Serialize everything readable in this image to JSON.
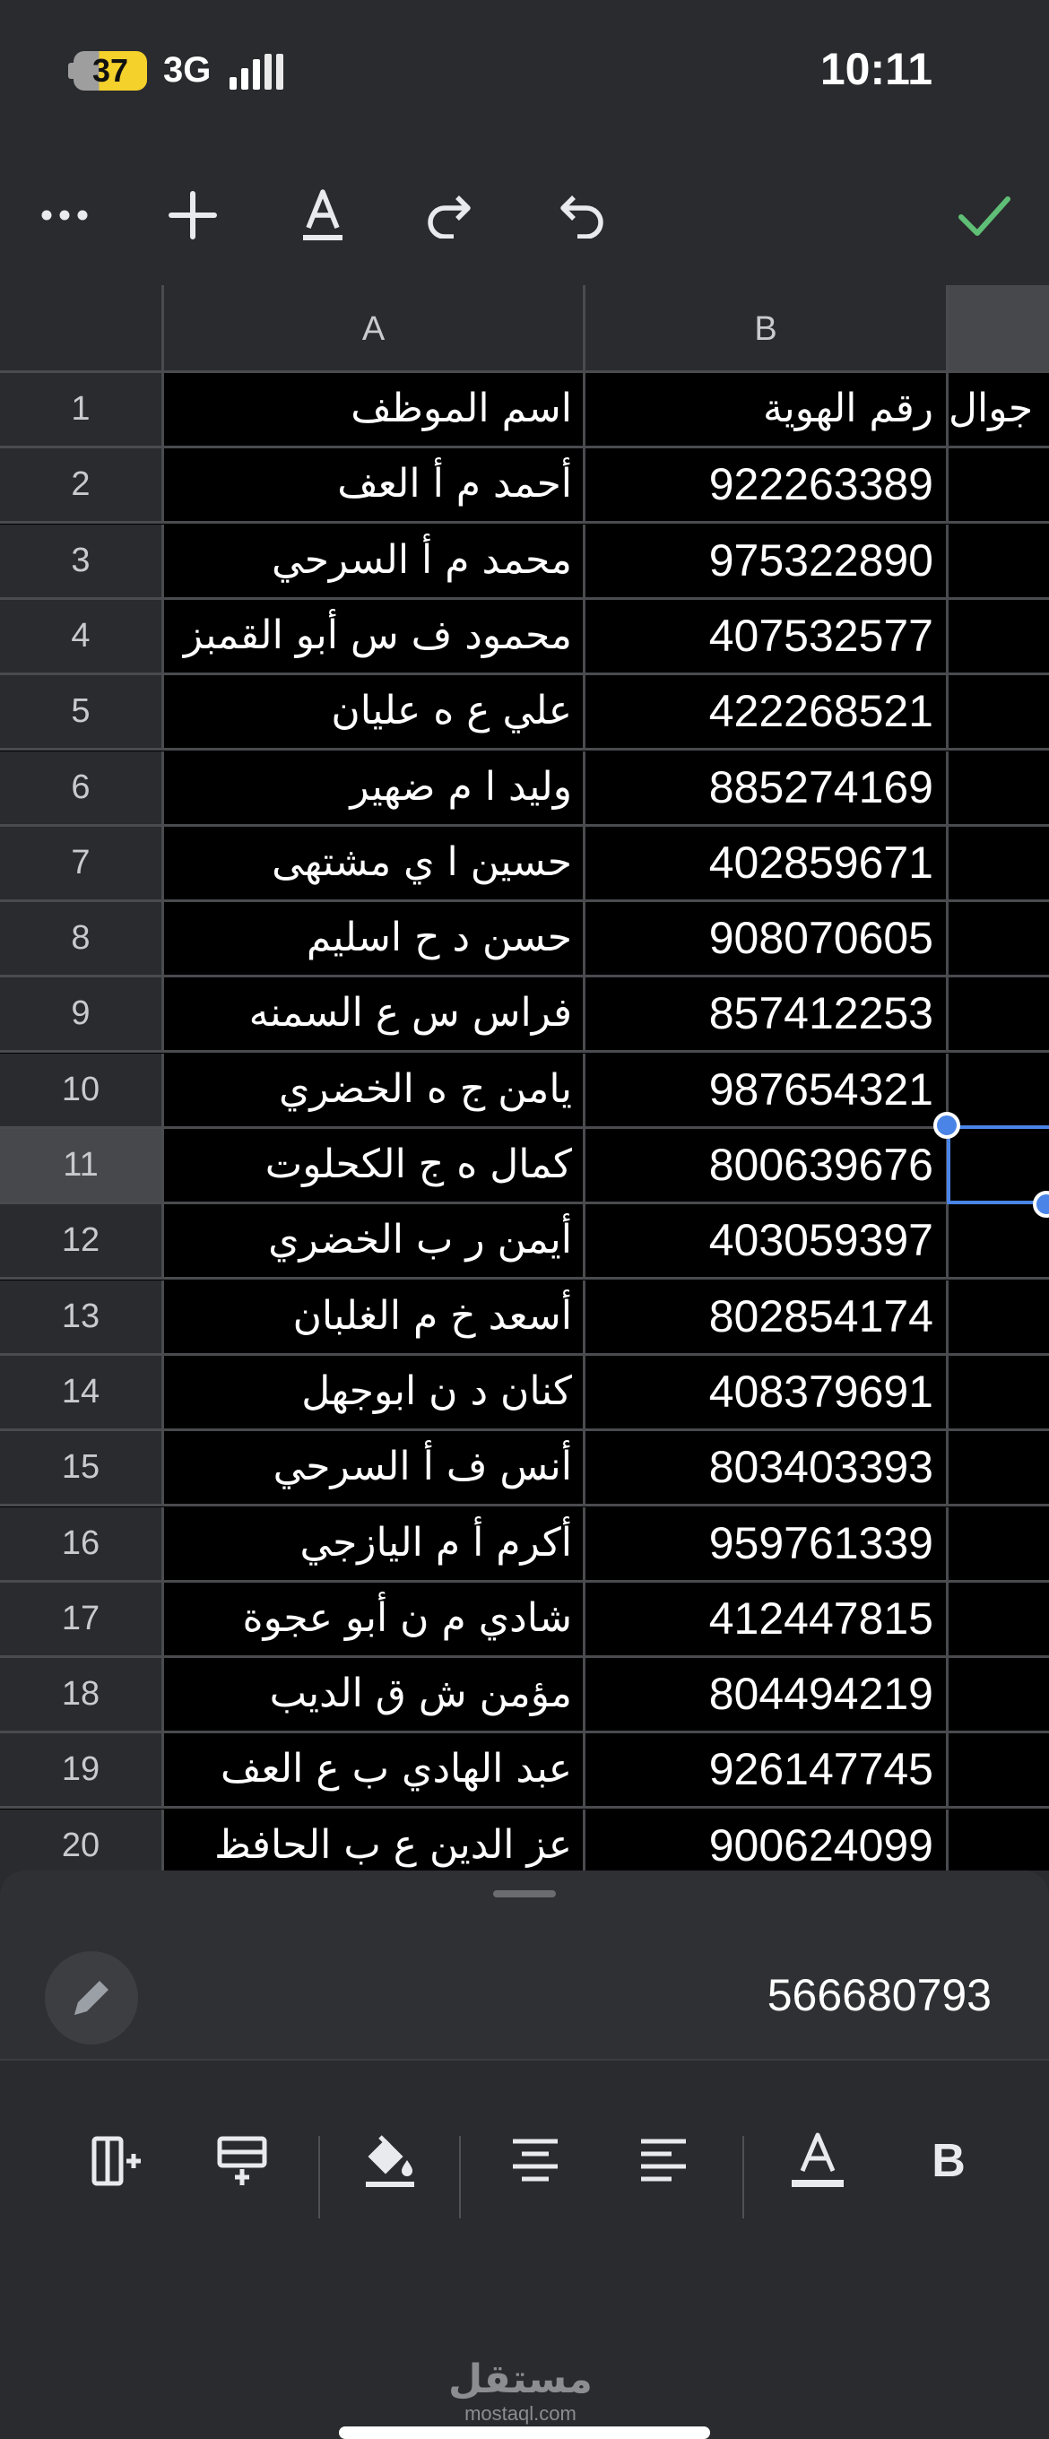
{
  "status_bar": {
    "time": "10:11",
    "battery": "37",
    "network": "3G"
  },
  "toolbar": {
    "more_icon": "more-horizontal-icon",
    "insert_icon": "plus-icon",
    "text_format_icon": "text-format-icon",
    "redo_icon": "redo-icon",
    "undo_icon": "undo-icon",
    "confirm_icon": "checkmark-icon",
    "confirm_color": "#5fbf76"
  },
  "columns": [
    "A",
    "B"
  ],
  "rows": [
    {
      "num": "1",
      "name": "اسم الموظف",
      "id": "رقم الهوية",
      "c": "جوال"
    },
    {
      "num": "2",
      "name": "أحمد م أ العف",
      "id": "922263389",
      "c": ""
    },
    {
      "num": "3",
      "name": "محمد م أ السرحي",
      "id": "975322890",
      "c": ""
    },
    {
      "num": "4",
      "name": "محمود ف س أبو القمبز",
      "id": "407532577",
      "c": ""
    },
    {
      "num": "5",
      "name": "علي ع ه عليان",
      "id": "422268521",
      "c": ""
    },
    {
      "num": "6",
      "name": "وليد ا م ضهير",
      "id": "885274169",
      "c": ""
    },
    {
      "num": "7",
      "name": "حسين ا ي مشتهى",
      "id": "402859671",
      "c": ""
    },
    {
      "num": "8",
      "name": "حسن د ح اسليم",
      "id": "908070605",
      "c": ""
    },
    {
      "num": "9",
      "name": "فراس س ع السمنه",
      "id": "857412253",
      "c": ""
    },
    {
      "num": "10",
      "name": "يامن ج ه الخضري",
      "id": "987654321",
      "c": ""
    },
    {
      "num": "11",
      "name": "كمال ه ج الكحلوت",
      "id": "800639676",
      "c": ""
    },
    {
      "num": "12",
      "name": "أيمن ر ب الخضري",
      "id": "403059397",
      "c": ""
    },
    {
      "num": "13",
      "name": "أسعد خ م الغلبان",
      "id": "802854174",
      "c": ""
    },
    {
      "num": "14",
      "name": "كنان د ن ابوجهل",
      "id": "408379691",
      "c": ""
    },
    {
      "num": "15",
      "name": "أنس ف أ السرحي",
      "id": "803403393",
      "c": ""
    },
    {
      "num": "16",
      "name": "أكرم أ م اليازجي",
      "id": "959761339",
      "c": ""
    },
    {
      "num": "17",
      "name": "شادي م ن أبو عجوة",
      "id": "412447815",
      "c": ""
    },
    {
      "num": "18",
      "name": "مؤمن  ش ق الديب",
      "id": "804494219",
      "c": ""
    },
    {
      "num": "19",
      "name": "عبد الهادي ب ع العف",
      "id": "926147745",
      "c": ""
    },
    {
      "num": "20",
      "name": "عز الدين ع ب الحافظ",
      "id": "900624099",
      "c": ""
    }
  ],
  "selected_row": "11",
  "selection_color": "#4a84e6",
  "formula_bar": {
    "value": "566680793",
    "edit_icon": "pencil-icon"
  },
  "format_bar": {
    "icons": [
      "insert-column-icon",
      "insert-row-icon",
      "fill-color-icon",
      "align-center-icon",
      "align-left-icon",
      "text-color-icon",
      "bold-icon"
    ],
    "bold_label": "B"
  },
  "watermark": {
    "main": "مستقل",
    "sub": "mostaql.com"
  }
}
